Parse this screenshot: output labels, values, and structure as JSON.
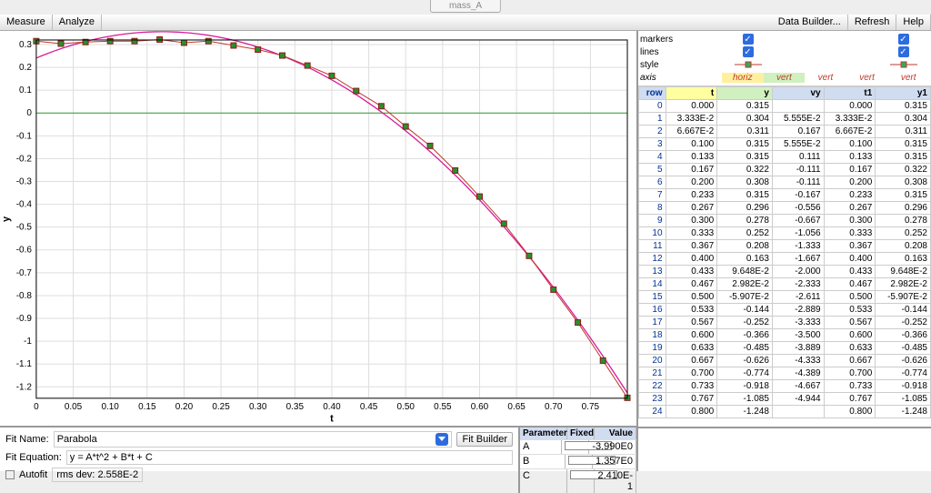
{
  "title_chip": "mass_A",
  "menu": {
    "measure": "Measure",
    "analyze": "Analyze",
    "data_builder": "Data Builder...",
    "refresh": "Refresh",
    "help": "Help"
  },
  "series_hdr": {
    "markers": "markers",
    "lines": "lines",
    "style": "style",
    "axis": "axis",
    "horiz": "horiz",
    "vert": "vert"
  },
  "table_header": {
    "row": "row",
    "t": "t",
    "y": "y",
    "vy": "vy",
    "t1": "t1",
    "y1": "y1"
  },
  "fit": {
    "name_label": "Fit Name:",
    "name_value": "Parabola",
    "builder_btn": "Fit Builder",
    "equation_label": "Fit Equation:",
    "equation_value": "y = A*t^2 + B*t + C",
    "autofit": "Autofit",
    "rms_label": "rms dev:",
    "rms_value": "2.558E-2"
  },
  "params": {
    "hdr": {
      "p": "Parameter",
      "f": "Fixed",
      "v": "Value"
    },
    "rows": [
      {
        "p": "A",
        "v": "-3.990E0"
      },
      {
        "p": "B",
        "v": "1.357E0"
      },
      {
        "p": "C",
        "v": "2.410E-1"
      }
    ]
  },
  "chart_data": {
    "type": "scatter",
    "title": "",
    "xlabel": "t",
    "ylabel": "y",
    "xlim": [
      0,
      0.8
    ],
    "ylim": [
      -1.25,
      0.32
    ],
    "xticks": [
      0,
      0.05,
      0.1,
      0.15,
      0.2,
      0.25,
      0.3,
      0.35,
      0.4,
      0.45,
      0.5,
      0.55,
      0.6,
      0.65,
      0.7,
      0.75
    ],
    "yticks": [
      0.3,
      0.2,
      0.1,
      -0.0,
      -0.1,
      -0.2,
      -0.3,
      -0.4,
      -0.5,
      -0.6,
      -0.7,
      -0.8,
      -0.9,
      -1.0,
      -1.1,
      -1.2
    ],
    "fit_equation": "y = -3.990*t^2 + 1.357*t + 0.2410",
    "points": [
      {
        "row": 0,
        "t": "0.000",
        "y": "0.315",
        "vy": "",
        "t1": "0.000",
        "y1": "0.315"
      },
      {
        "row": 1,
        "t": "3.333E-2",
        "y": "0.304",
        "vy": "5.555E-2",
        "t1": "3.333E-2",
        "y1": "0.304"
      },
      {
        "row": 2,
        "t": "6.667E-2",
        "y": "0.311",
        "vy": "0.167",
        "t1": "6.667E-2",
        "y1": "0.311"
      },
      {
        "row": 3,
        "t": "0.100",
        "y": "0.315",
        "vy": "5.555E-2",
        "t1": "0.100",
        "y1": "0.315"
      },
      {
        "row": 4,
        "t": "0.133",
        "y": "0.315",
        "vy": "0.111",
        "t1": "0.133",
        "y1": "0.315"
      },
      {
        "row": 5,
        "t": "0.167",
        "y": "0.322",
        "vy": "-0.111",
        "t1": "0.167",
        "y1": "0.322"
      },
      {
        "row": 6,
        "t": "0.200",
        "y": "0.308",
        "vy": "-0.111",
        "t1": "0.200",
        "y1": "0.308"
      },
      {
        "row": 7,
        "t": "0.233",
        "y": "0.315",
        "vy": "-0.167",
        "t1": "0.233",
        "y1": "0.315"
      },
      {
        "row": 8,
        "t": "0.267",
        "y": "0.296",
        "vy": "-0.556",
        "t1": "0.267",
        "y1": "0.296"
      },
      {
        "row": 9,
        "t": "0.300",
        "y": "0.278",
        "vy": "-0.667",
        "t1": "0.300",
        "y1": "0.278"
      },
      {
        "row": 10,
        "t": "0.333",
        "y": "0.252",
        "vy": "-1.056",
        "t1": "0.333",
        "y1": "0.252"
      },
      {
        "row": 11,
        "t": "0.367",
        "y": "0.208",
        "vy": "-1.333",
        "t1": "0.367",
        "y1": "0.208"
      },
      {
        "row": 12,
        "t": "0.400",
        "y": "0.163",
        "vy": "-1.667",
        "t1": "0.400",
        "y1": "0.163"
      },
      {
        "row": 13,
        "t": "0.433",
        "y": "9.648E-2",
        "vy": "-2.000",
        "t1": "0.433",
        "y1": "9.648E-2"
      },
      {
        "row": 14,
        "t": "0.467",
        "y": "2.982E-2",
        "vy": "-2.333",
        "t1": "0.467",
        "y1": "2.982E-2"
      },
      {
        "row": 15,
        "t": "0.500",
        "y": "-5.907E-2",
        "vy": "-2.611",
        "t1": "0.500",
        "y1": "-5.907E-2"
      },
      {
        "row": 16,
        "t": "0.533",
        "y": "-0.144",
        "vy": "-2.889",
        "t1": "0.533",
        "y1": "-0.144"
      },
      {
        "row": 17,
        "t": "0.567",
        "y": "-0.252",
        "vy": "-3.333",
        "t1": "0.567",
        "y1": "-0.252"
      },
      {
        "row": 18,
        "t": "0.600",
        "y": "-0.366",
        "vy": "-3.500",
        "t1": "0.600",
        "y1": "-0.366"
      },
      {
        "row": 19,
        "t": "0.633",
        "y": "-0.485",
        "vy": "-3.889",
        "t1": "0.633",
        "y1": "-0.485"
      },
      {
        "row": 20,
        "t": "0.667",
        "y": "-0.626",
        "vy": "-4.333",
        "t1": "0.667",
        "y1": "-0.626"
      },
      {
        "row": 21,
        "t": "0.700",
        "y": "-0.774",
        "vy": "-4.389",
        "t1": "0.700",
        "y1": "-0.774"
      },
      {
        "row": 22,
        "t": "0.733",
        "y": "-0.918",
        "vy": "-4.667",
        "t1": "0.733",
        "y1": "-0.918"
      },
      {
        "row": 23,
        "t": "0.767",
        "y": "-1.085",
        "vy": "-4.944",
        "t1": "0.767",
        "y1": "-1.085"
      },
      {
        "row": 24,
        "t": "0.800",
        "y": "-1.248",
        "vy": "",
        "t1": "0.800",
        "y1": "-1.248"
      }
    ]
  }
}
